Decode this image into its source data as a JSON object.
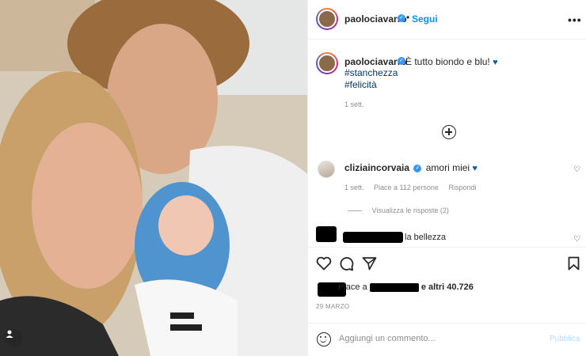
{
  "post": {
    "author": "paolociavarro",
    "follow_label": "Segui",
    "dot": "•",
    "more": "•••"
  },
  "caption": {
    "author": "paolociavarro",
    "text": "È tutto biondo e blu!",
    "heart": "♥",
    "hashtags": [
      "#stanchezza",
      "#felicità"
    ],
    "time": "1 sett."
  },
  "comments": [
    {
      "author": "cliziaincorvaia",
      "text": "amori miei",
      "heart": "♥",
      "time": "1 sett.",
      "likes": "Piace a 112 persone",
      "reply": "Rispondi",
      "view_replies": "Visualizza le risposte (2)"
    },
    {
      "text": "la bellezza"
    }
  ],
  "likes": {
    "prefix": "Piace a",
    "suffix": "e altri 40.726"
  },
  "date": "29 MARZO",
  "add_comment": {
    "placeholder": "Aggiungi un commento...",
    "publish": "Pubblica"
  },
  "colors": {
    "link": "#0095f6",
    "verified": "#3897f0",
    "hashtag": "#00376b",
    "muted": "#8e8e8e"
  }
}
